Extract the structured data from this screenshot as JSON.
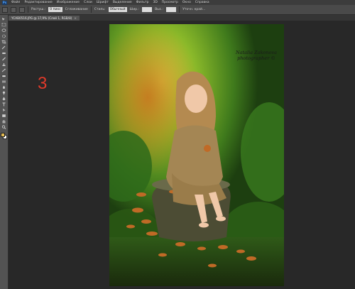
{
  "app": {
    "logo": "Ps"
  },
  "menu": {
    "items": [
      "Файл",
      "Редактирование",
      "Изображение",
      "Слои",
      "Шрифт",
      "Выделение",
      "Фильтр",
      "3D",
      "Просмотр",
      "Окно",
      "Справка"
    ]
  },
  "options": {
    "feather_label": "Растуш.:",
    "feather_value": "0 пикс",
    "smoothing_label": "Сглаживание",
    "style_label": "Стиль:",
    "style_value": "Обычный",
    "width_label": "Шир.:",
    "height_label": "Выс.:",
    "refine_label": "Уточн. край..."
  },
  "document": {
    "tab_title": "YCAB0516.JPG @ 17,9% (Слой 1, RGB/8)",
    "close": "×"
  },
  "colors": {
    "foreground": "#e0b850",
    "background": "#ffffff"
  },
  "tools": [
    "move-tool",
    "marquee-tool",
    "lasso-tool",
    "quick-select-tool",
    "crop-tool",
    "eyedropper-tool",
    "healing-tool",
    "brush-tool",
    "clone-stamp-tool",
    "history-brush-tool",
    "eraser-tool",
    "gradient-tool",
    "blur-tool",
    "dodge-tool",
    "pen-tool",
    "type-tool",
    "path-select-tool",
    "shape-tool",
    "hand-tool",
    "zoom-tool"
  ],
  "canvas": {
    "step_number": "3",
    "watermark_line1": "Natalia Zakonova",
    "watermark_line2": "photographer ©"
  }
}
